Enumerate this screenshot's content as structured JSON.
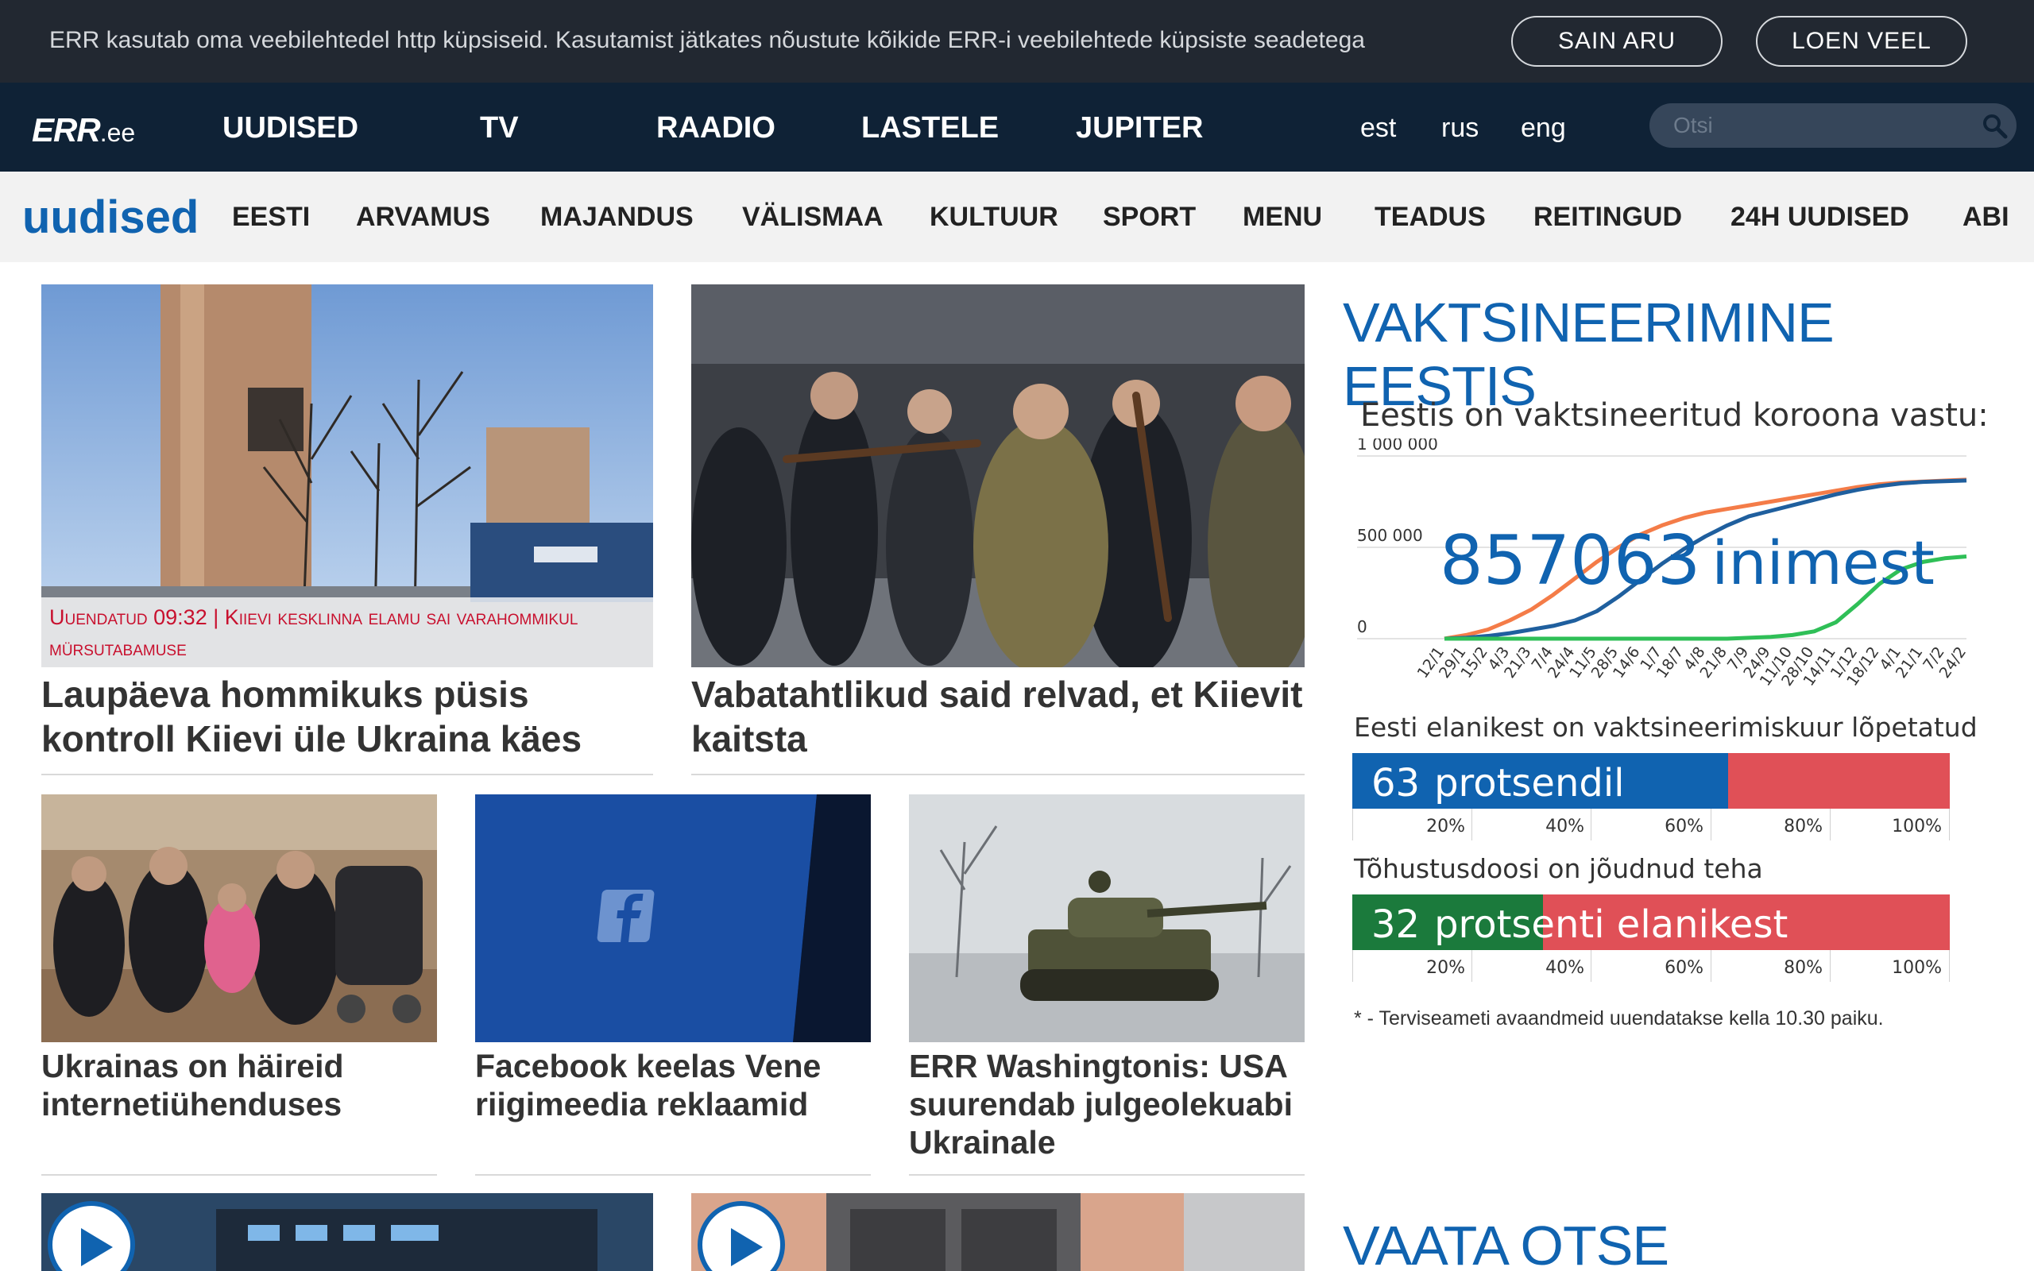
{
  "cookie": {
    "text": "ERR kasutab oma veebilehtedel http küpsiseid. Kasutamist jätkates nõustute kõikide ERR-i veebilehtede küpsiste seadetega",
    "accept_label": "SAIN ARU",
    "more_label": "LOEN VEEL"
  },
  "topnav": {
    "logo": "ERR",
    "logo_suffix": ".ee",
    "items": [
      "UUDISED",
      "TV",
      "RAADIO",
      "LASTELE",
      "JUPITER"
    ],
    "languages": [
      "est",
      "rus",
      "eng"
    ],
    "search_placeholder": "Otsi"
  },
  "section": {
    "brand": "uudised",
    "items": [
      "EESTI",
      "ARVAMUS",
      "MAJANDUS",
      "VÄLISMAA",
      "KULTUUR",
      "SPORT",
      "MENU",
      "TEADUS",
      "REITINGUD",
      "24H UUDISED",
      "ABI"
    ]
  },
  "articles": {
    "lead1": {
      "overlay": "Uuendatud 09:32 | Kiievi kesklinna elamu sai varahommikul mürsutabamuse",
      "title": "Laupäeva hommikuks püsis kontroll Kiievi üle Ukraina käes"
    },
    "lead2": {
      "title": "Vabatahtlikud said relvad, et Kiievit kaitsta"
    },
    "small1": {
      "title": "Ukrainas on häireid internetiühenduses"
    },
    "small2": {
      "title": "Facebook keelas Vene riigimeedia reklaamid"
    },
    "small3": {
      "title": "ERR Washingtonis: USA suurendab julgeolekuabi Ukrainale"
    }
  },
  "sidebar": {
    "title": "VAKTSINEERIMINE EESTIS",
    "chart_heading": "Eestis on vaktsineeritud koroona vastu:",
    "big_number": "857063",
    "big_unit": "inimest",
    "bar1_heading": "Eesti elanikest on vaktsineerimiskuur lõpetatud",
    "bar1_value": "63",
    "bar1_text": "protsendil",
    "bar2_heading": "Tõhustusdoosi on jõudnud teha",
    "bar2_value": "32",
    "bar2_text": "protsenti elanikest",
    "ticks": [
      "20%",
      "40%",
      "60%",
      "80%",
      "100%"
    ],
    "footnote": "* - Terviseameti avaandmeid uuendatakse kella 10.30 paiku.",
    "second_title": "VAATA OTSE",
    "colors": {
      "accent": "#1063b0",
      "bar_remaining": "#e05057",
      "bar1": "#1063b0",
      "bar2": "#1b7a3c",
      "line_orange": "#f47c48",
      "line_blue": "#1f5f9e",
      "line_green": "#2fbf57"
    }
  },
  "chart_data": {
    "type": "line",
    "title": "Eestis on vaktsineeritud koroona vastu:",
    "x": [
      "12/1",
      "29/1",
      "15/2",
      "4/3",
      "21/3",
      "7/4",
      "24/4",
      "11/5",
      "28/5",
      "14/6",
      "1/7",
      "18/7",
      "4/8",
      "21/8",
      "7/9",
      "24/9",
      "11/10",
      "28/10",
      "14/11",
      "1/12",
      "18/12",
      "4/1",
      "21/1",
      "7/2",
      "24/2"
    ],
    "ylim": [
      0,
      1000000
    ],
    "yticks": [
      "0",
      "500 000",
      "1 000 000"
    ],
    "series": [
      {
        "values": [
          0,
          20000,
          50000,
          100000,
          160000,
          240000,
          330000,
          420000,
          500000,
          570000,
          620000,
          660000,
          690000,
          710000,
          730000,
          750000,
          770000,
          790000,
          810000,
          830000,
          845000,
          855000,
          860000,
          865000,
          870000
        ]
      },
      {
        "values": [
          0,
          5000,
          15000,
          30000,
          50000,
          70000,
          100000,
          150000,
          230000,
          320000,
          410000,
          490000,
          560000,
          620000,
          670000,
          700000,
          730000,
          760000,
          790000,
          815000,
          835000,
          850000,
          858000,
          862000,
          866000
        ]
      },
      {
        "values": [
          0,
          0,
          0,
          0,
          0,
          0,
          0,
          0,
          0,
          0,
          0,
          0,
          0,
          0,
          5000,
          10000,
          20000,
          40000,
          90000,
          190000,
          300000,
          380000,
          420000,
          440000,
          450000
        ]
      }
    ]
  }
}
